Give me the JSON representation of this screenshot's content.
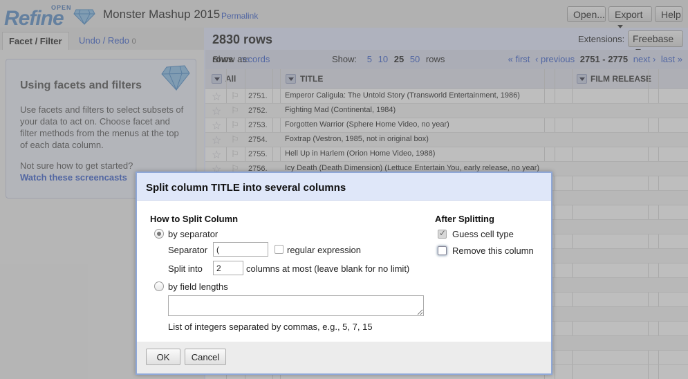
{
  "header": {
    "logo_open": "OPEN",
    "logo_refine": "Refine",
    "project_name": "Monster Mashup 2015",
    "permalink": "Permalink",
    "open_button": "Open...",
    "export_button": "Export",
    "help_button": "Help"
  },
  "left_panel": {
    "tabs": [
      {
        "label": "Facet / Filter"
      },
      {
        "label": "Undo / Redo",
        "count": "0"
      }
    ],
    "help": {
      "title": "Using facets and filters",
      "text": "Use facets and filters to select subsets of your data to act on. Choose facet and filter methods from the menus at the top of each data column.",
      "question": "Not sure how to get started?",
      "link": "Watch these screencasts"
    }
  },
  "main": {
    "row_count": "2830 rows",
    "extensions_label": "Extensions:",
    "extensions_button": "Freebase",
    "show_as_label": "Show as:",
    "show_as_rows": "rows",
    "show_as_records": "records",
    "show_label": "Show:",
    "page_sizes": [
      "5",
      "10",
      "25",
      "50"
    ],
    "show_suffix": "rows",
    "pager": {
      "first": "« first",
      "previous": "‹ previous",
      "range": "2751 - 2775",
      "next": "next ›",
      "last": "last »"
    },
    "columns": [
      "All",
      "TITLE",
      "FILM RELEASE"
    ],
    "rows": [
      {
        "num": "2751.",
        "title": "Emperor Caligula: The Untold Story (Transworld Entertainment, 1986)"
      },
      {
        "num": "2752.",
        "title": "Fighting Mad (Continental, 1984)"
      },
      {
        "num": "2753.",
        "title": "Forgotten Warrior (Sphere Home Video, no year)"
      },
      {
        "num": "2754.",
        "title": "Foxtrap (Vestron, 1985, not in original box)"
      },
      {
        "num": "2755.",
        "title": "Hell Up in Harlem (Orion Home Video, 1988)"
      },
      {
        "num": "2756.",
        "title": "Icy Death (Death Dimension) (Lettuce Entertain You, early release, no year)"
      }
    ]
  },
  "dialog": {
    "title": "Split column TITLE into several columns",
    "how_heading": "How to Split Column",
    "by_separator": "by separator",
    "separator_label": "Separator",
    "separator_value": "(",
    "regex_label": "regular expression",
    "split_into_label": "Split into",
    "split_into_value": "2",
    "split_into_suffix": "columns at most (leave blank for no limit)",
    "by_field_lengths": "by field lengths",
    "field_lengths_value": "",
    "field_lengths_hint": "List of integers separated by commas, e.g., 5, 7, 15",
    "after_heading": "After Splitting",
    "guess_cell_type": "Guess cell type",
    "guess_cell_type_checked": true,
    "remove_column": "Remove this column",
    "remove_column_checked": false,
    "ok_button": "OK",
    "cancel_button": "Cancel"
  },
  "colors": {
    "accent_link": "#3a5fcd",
    "dialog_header": "#dfe7f9",
    "logo_blue": "#5b8fc7"
  }
}
